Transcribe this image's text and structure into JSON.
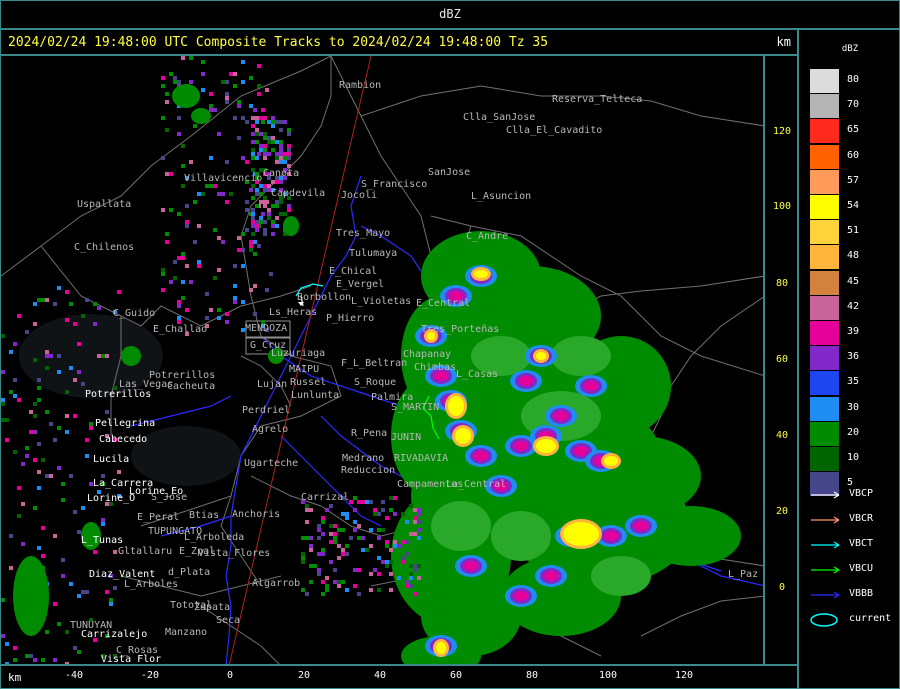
{
  "window": {
    "title": "dBZ"
  },
  "header": {
    "text": "2024/02/24 19:48:00 UTC Composite Tracks to 2024/02/24 19:48:00 Tz 35",
    "unit_top": "km",
    "unit_bottom": "km"
  },
  "axes": {
    "y_ticks": [
      "120",
      "100",
      "80",
      "60",
      "40",
      "20",
      "0"
    ],
    "x_ticks": [
      "-40",
      "-20",
      "0",
      "20",
      "40",
      "60",
      "80",
      "100",
      "120"
    ]
  },
  "legend": {
    "title": "dBZ",
    "scale": [
      {
        "label": "80",
        "color": "#dcdcdc"
      },
      {
        "label": "70",
        "color": "#b4b4b4"
      },
      {
        "label": "65",
        "color": "#ff2a1e"
      },
      {
        "label": "60",
        "color": "#ff6000"
      },
      {
        "label": "57",
        "color": "#ff9a5a"
      },
      {
        "label": "54",
        "color": "#ffff00"
      },
      {
        "label": "51",
        "color": "#ffd23c"
      },
      {
        "label": "48",
        "color": "#ffb43c"
      },
      {
        "label": "45",
        "color": "#d2823c"
      },
      {
        "label": "42",
        "color": "#c8649a"
      },
      {
        "label": "39",
        "color": "#e6009a"
      },
      {
        "label": "36",
        "color": "#8228c8"
      },
      {
        "label": "35",
        "color": "#1e46f0"
      },
      {
        "label": "30",
        "color": "#1e8cf0"
      },
      {
        "label": "20",
        "color": "#008c00"
      },
      {
        "label": "10",
        "color": "#006400"
      },
      {
        "label": "5",
        "color": "#46468c"
      }
    ],
    "tracks": [
      {
        "label": "VBCP",
        "color": "#ffffff"
      },
      {
        "label": "VBCR",
        "color": "#ff9a6a"
      },
      {
        "label": "VBCT",
        "color": "#00ffff"
      },
      {
        "label": "VBCU",
        "color": "#00ff00"
      },
      {
        "label": "VBBB",
        "color": "#2a2aff"
      },
      {
        "label": "current",
        "color": "#00ffff"
      }
    ]
  },
  "places": {
    "gray": [
      "Rambion",
      "Reserva_Telteca",
      "Clla_SanJose",
      "Clla_El_Cavadito",
      "SanJose",
      "L_Asuncion",
      "Villavicencio",
      "Canota",
      "Capdevila",
      "S_Francisco",
      "Uspallata",
      "Jocoli",
      "C_Chilenos",
      "Tres_Mayo",
      "C_Andre",
      "Tulumaya",
      "E_Chical",
      "E_Vergel",
      "Borbollon",
      "L_Violetas",
      "E_Central",
      "C_Guido",
      "P_Hierro",
      "E_Challao",
      "MENDOZA",
      "G_Cruz",
      "Chapanay",
      "Luzuriaga",
      "F_L_Beltran",
      "Chimbas",
      "L_Casas",
      "MAIPU",
      "Potrerillos",
      "Russel",
      "S_Roque",
      "Palmira",
      "Las_Vegas",
      "Cacheuta",
      "Lujan",
      "Lunlunta",
      "S_MARTIN",
      "Perdriel",
      "Agrelo",
      "R_Pena",
      "JUNIN",
      "RIVADAVIA",
      "Medrano",
      "Reduccion",
      "Ugarteche",
      "Campamentos",
      "La_Central",
      "Carrizal",
      "E_Peral",
      "S_Jose",
      "Btias",
      "Anchoris",
      "TUPUNGATO",
      "L_Arboleda",
      "Gltallaru",
      "E_Zpal",
      "d_Plata",
      "L_Arboles",
      "Algarrob",
      "Zapata",
      "Tototal",
      "Seca",
      "TUNUYAN",
      "Manzano",
      "C_Rosas",
      "Vista_Flores",
      "Ls_Heras",
      "Tres_Porteñas",
      "L_Paz"
    ],
    "white": [
      "Potrerillos",
      "Pellegrina",
      "Cabecedo",
      "Lucila",
      "La_Carrera",
      "Lorine_Eo",
      "Lorine_O",
      "L_Tunas",
      "Diaz_Valent",
      "Carrizalejo",
      "Vista_Flor"
    ]
  }
}
